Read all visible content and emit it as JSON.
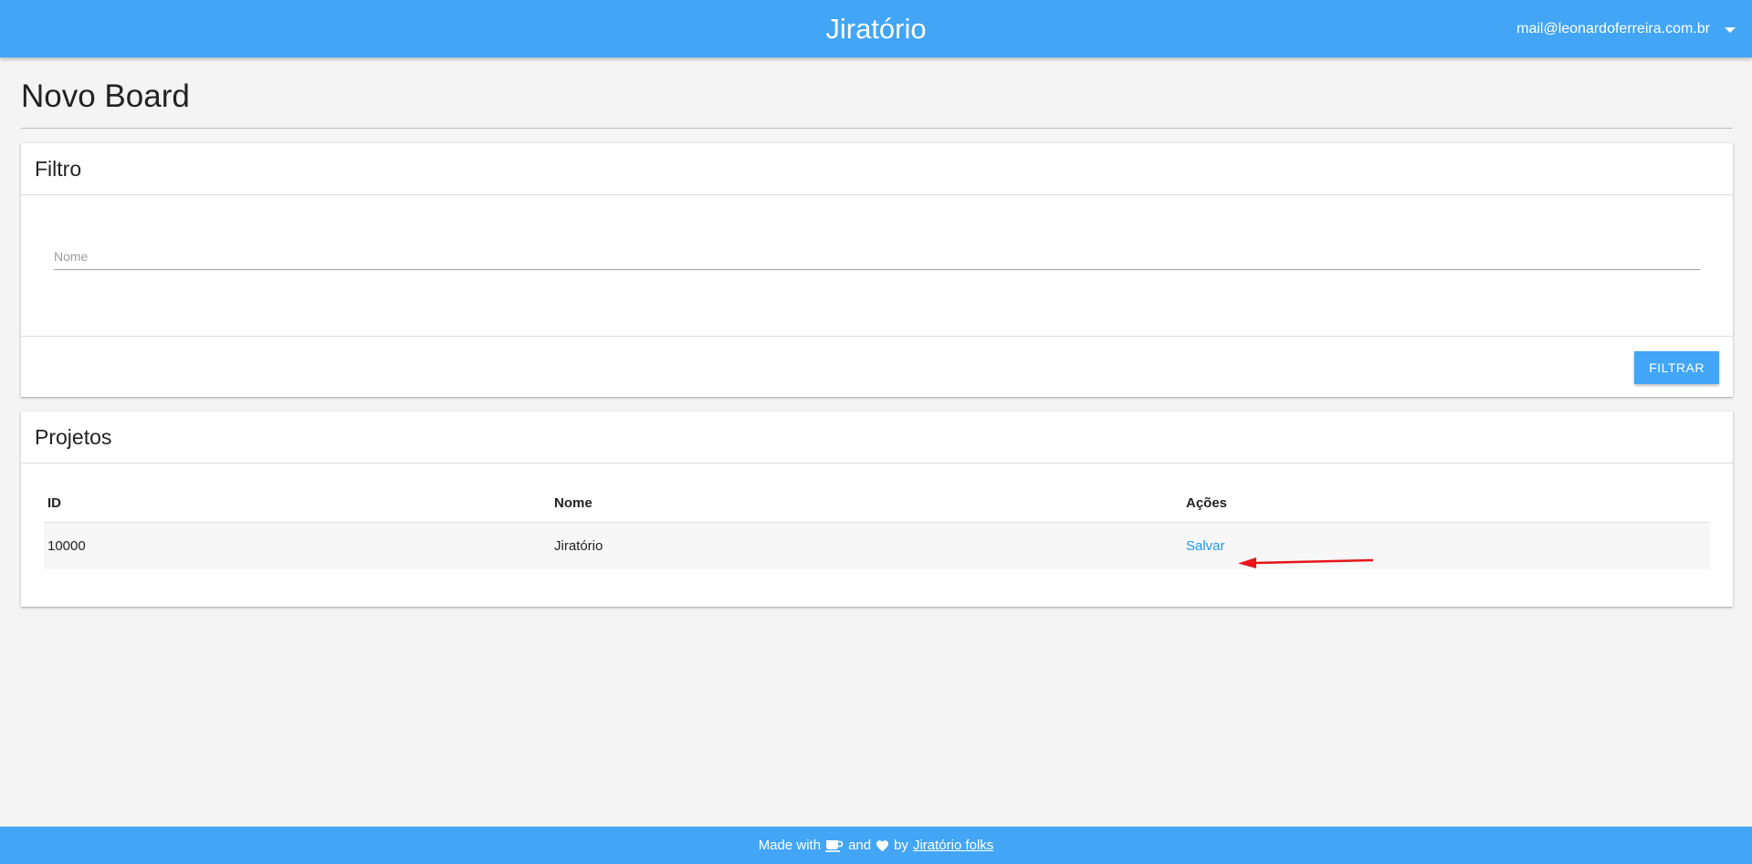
{
  "header": {
    "app_title": "Jiratório",
    "user_email": "mail@leonardoferreira.com.br"
  },
  "page": {
    "title": "Novo Board"
  },
  "filter_card": {
    "title": "Filtro",
    "name_placeholder": "Nome",
    "name_value": "",
    "button_label": "FILTRAR"
  },
  "projects_card": {
    "title": "Projetos",
    "columns": [
      "ID",
      "Nome",
      "Ações"
    ],
    "rows": [
      {
        "id": "10000",
        "nome": "Jiratório",
        "action": "Salvar"
      }
    ]
  },
  "annotation": {
    "arrow_color": "#e8141a"
  },
  "footer": {
    "made_with": "Made with",
    "and": "and",
    "by": "by",
    "link_text": "Jiratório folks",
    "coffee_icon": "coffee-icon",
    "heart_icon": "heart-icon"
  },
  "colors": {
    "primary": "#42a5f5",
    "link": "#2196f3",
    "background": "#f4f4f4"
  }
}
